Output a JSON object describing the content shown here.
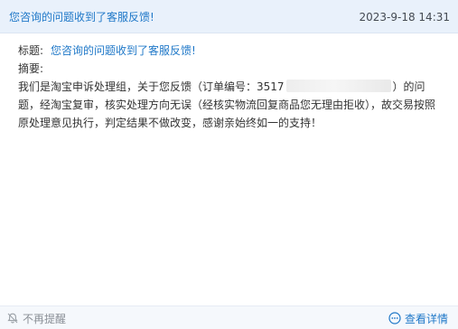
{
  "header": {
    "title": "您咨询的问题收到了客服反馈!",
    "timestamp": "2023-9-18 14:31"
  },
  "message": {
    "subject_label": "标题:",
    "subject_value": "您咨询的问题收到了客服反馈!",
    "summary_label": "摘要:",
    "content_before": "我们是淘宝申诉处理组，关于您反馈（订单编号：3517",
    "content_after": "）的问题，经淘宝复审，核实处理方向无误（经核实物流回复商品您无理由拒收），故交易按照原处理意见执行，判定结果不做改变，感谢亲始终如一的支持！"
  },
  "footer": {
    "no_remind_label": "不再提醒",
    "view_detail_label": "查看详情"
  },
  "icons": {
    "no_remind": "bell-off-icon",
    "view_detail": "more-circle-icon"
  },
  "colors": {
    "accent": "#1f78c8",
    "header_bg": "#e9f1fb",
    "muted": "#8a8f96"
  }
}
